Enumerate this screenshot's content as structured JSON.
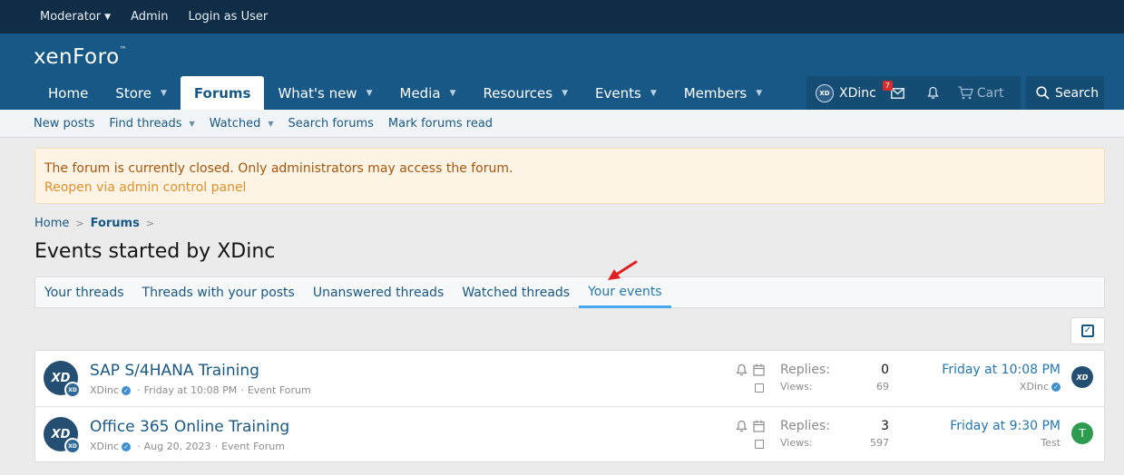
{
  "admin_bar": {
    "moderator": "Moderator",
    "admin": "Admin",
    "login_as_user": "Login as User"
  },
  "header": {
    "logo": "xenForo",
    "logo_mark": "™"
  },
  "nav": {
    "tabs": [
      {
        "label": "Home",
        "caret": false
      },
      {
        "label": "Store",
        "caret": true
      },
      {
        "label": "Forums",
        "caret": false,
        "active": true
      },
      {
        "label": "What's new",
        "caret": true
      },
      {
        "label": "Media",
        "caret": true
      },
      {
        "label": "Resources",
        "caret": true
      },
      {
        "label": "Events",
        "caret": true
      },
      {
        "label": "Members",
        "caret": true
      }
    ],
    "user": {
      "name": "XDinc",
      "avatar_text": "XD"
    },
    "inbox_badge": "7",
    "cart_label": "Cart",
    "search_label": "Search"
  },
  "subnav": {
    "new_posts": "New posts",
    "find_threads": "Find threads",
    "watched": "Watched",
    "search_forums": "Search forums",
    "mark_read": "Mark forums read"
  },
  "notice": {
    "text": "The forum is currently closed. Only administrators may access the forum.",
    "link": "Reopen via admin control panel"
  },
  "breadcrumb": {
    "home": "Home",
    "forums": "Forums"
  },
  "page_title": "Events started by XDinc",
  "filter_tabs": {
    "your_threads": "Your threads",
    "threads_with_posts": "Threads with your posts",
    "unanswered": "Unanswered threads",
    "watched_threads": "Watched threads",
    "your_events": "Your events"
  },
  "threads": [
    {
      "title": "SAP S/4HANA Training",
      "author": "XDinc",
      "date": "Friday at 10:08 PM",
      "forum": "Event Forum",
      "replies_label": "Replies:",
      "replies": "0",
      "views_label": "Views:",
      "views": "69",
      "last_date": "Friday at 10:08 PM",
      "last_user": "XDinc",
      "avatar_text": "XD",
      "last_avatar_text": "XD"
    },
    {
      "title": "Office 365 Online Training",
      "author": "XDinc",
      "date": "Aug 20, 2023",
      "forum": "Event Forum",
      "replies_label": "Replies:",
      "replies": "3",
      "views_label": "Views:",
      "views": "597",
      "last_date": "Friday at 9:30 PM",
      "last_user": "Test",
      "avatar_text": "XD",
      "last_avatar_text": "T"
    }
  ],
  "colors": {
    "admin_bar": "#0f2d46",
    "header": "#185886",
    "link": "#185886",
    "accent": "#47a7eb",
    "notice_bg": "#fdf4e6",
    "notice_text": "#a7560b",
    "annotation_arrow": "#e02020"
  },
  "icons": {
    "inbox": "envelope-icon",
    "alerts": "bell-icon",
    "cart": "cart-icon",
    "search": "search-icon",
    "filter": "checkbox-icon",
    "watch": "bell-icon",
    "calendar": "calendar-icon"
  }
}
